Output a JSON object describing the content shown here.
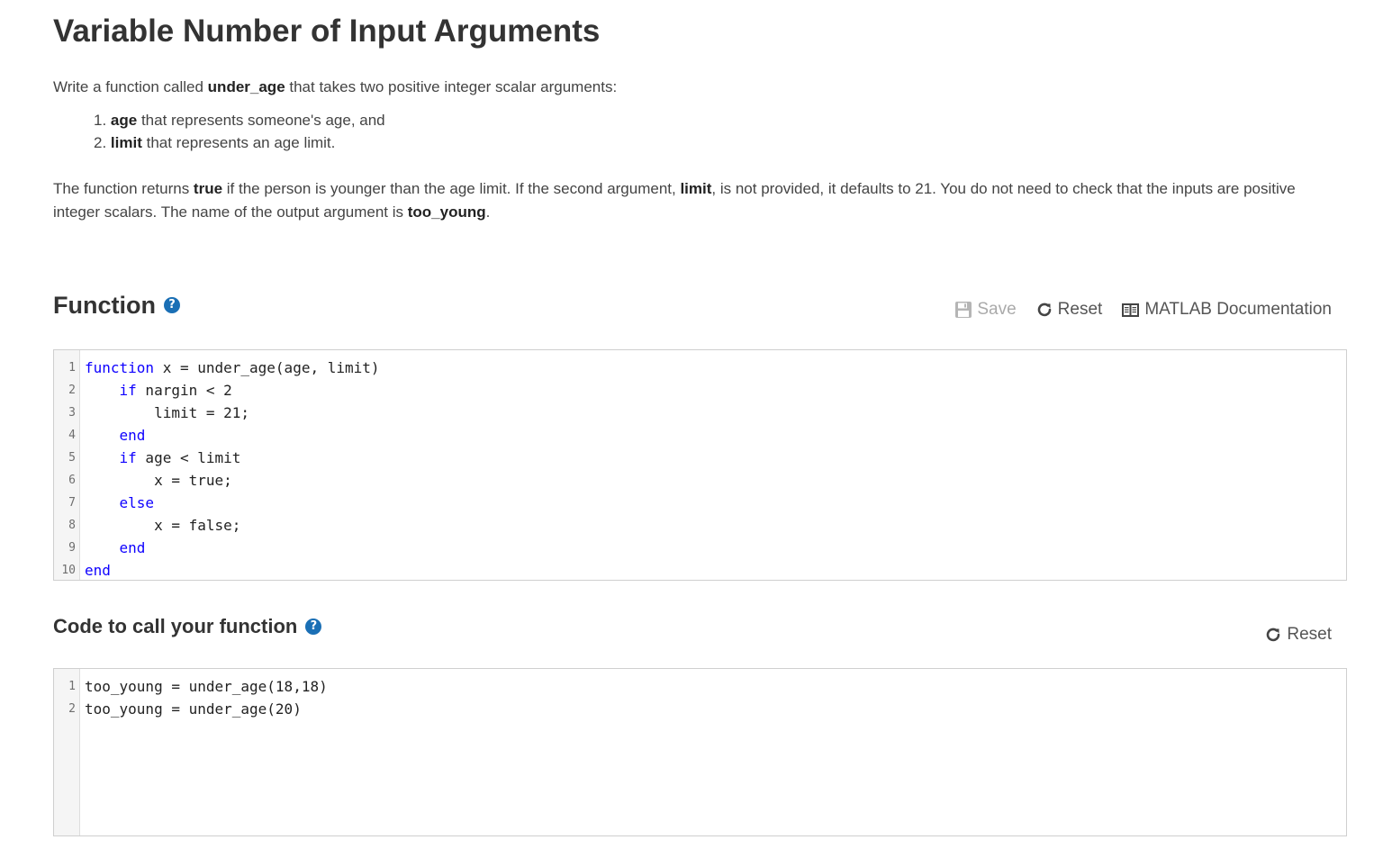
{
  "title": "Variable Number of Input Arguments",
  "intro": {
    "pre": "Write a function called ",
    "fn_name": "under_age",
    "post": " that takes two positive integer scalar arguments:"
  },
  "args": [
    {
      "num": "1.",
      "name": "age",
      "desc": " that represents someone's age, and"
    },
    {
      "num": "2.",
      "name": "limit",
      "desc": " that represents an age limit."
    }
  ],
  "description": {
    "t1": "The function returns ",
    "b1": "true",
    "t2": " if the person is younger than the age limit. If the second argument, ",
    "b2": "limit",
    "t3": ", is not provided, it defaults to 21. You do not need to check that the inputs are positive integer scalars. The name of the output argument is ",
    "b3": "too_young",
    "t4": "."
  },
  "function_section": {
    "heading": "Function",
    "help_icon": "question-circle-icon",
    "toolbar": {
      "save": "Save",
      "reset": "Reset",
      "docs": "MATLAB Documentation"
    },
    "code_lines": [
      {
        "n": "1",
        "kw": "function",
        "rest": " x = under_age(age, limit)"
      },
      {
        "n": "2",
        "indent": "    ",
        "kw": "if",
        "rest": " nargin < 2"
      },
      {
        "n": "3",
        "indent": "        ",
        "kw": "",
        "rest": "limit = 21;"
      },
      {
        "n": "4",
        "indent": "    ",
        "kw": "end",
        "rest": ""
      },
      {
        "n": "5",
        "indent": "    ",
        "kw": "if",
        "rest": " age < limit"
      },
      {
        "n": "6",
        "indent": "        ",
        "kw": "",
        "rest": "x = true;"
      },
      {
        "n": "7",
        "indent": "    ",
        "kw": "else",
        "rest": ""
      },
      {
        "n": "8",
        "indent": "        ",
        "kw": "",
        "rest": "x = false;"
      },
      {
        "n": "9",
        "indent": "    ",
        "kw": "end",
        "rest": ""
      },
      {
        "n": "10",
        "kw": "end",
        "rest": ""
      }
    ]
  },
  "call_section": {
    "heading": "Code to call your function",
    "help_icon": "question-circle-icon",
    "reset": "Reset",
    "code_lines": [
      {
        "n": "1",
        "text": "too_young = under_age(18,18)"
      },
      {
        "n": "2",
        "text": "too_young = under_age(20)"
      }
    ]
  },
  "colors": {
    "keyword": "#0e00ff",
    "help_icon": "#1a6fb5"
  }
}
